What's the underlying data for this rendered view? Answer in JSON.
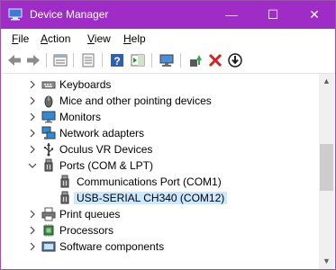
{
  "window": {
    "title": "Device Manager",
    "controls": {
      "minimize": "—",
      "maximize": "☐",
      "close": "✕"
    }
  },
  "menu": [
    {
      "label": "File",
      "hotkey": "F"
    },
    {
      "label": "Action",
      "hotkey": "A"
    },
    {
      "label": "View",
      "hotkey": "V"
    },
    {
      "label": "Help",
      "hotkey": "H"
    }
  ],
  "toolbar": {
    "buttons": [
      "back-icon",
      "forward-icon",
      "properties-icon",
      "show-hide-icon",
      "help-icon",
      "action-pane-icon",
      "monitor-icon",
      "update-driver-icon",
      "uninstall-icon",
      "scan-download-icon"
    ]
  },
  "tree": {
    "items": [
      {
        "label": "Keyboards",
        "expander": "collapsed",
        "icon": "keyboard-icon"
      },
      {
        "label": "Mice and other pointing devices",
        "expander": "collapsed",
        "icon": "mouse-icon"
      },
      {
        "label": "Monitors",
        "expander": "collapsed",
        "icon": "monitor-icon"
      },
      {
        "label": "Network adapters",
        "expander": "collapsed",
        "icon": "network-icon"
      },
      {
        "label": "Oculus VR Devices",
        "expander": "collapsed",
        "icon": "usb-icon"
      },
      {
        "label": "Ports (COM & LPT)",
        "expander": "expanded",
        "icon": "port-icon"
      },
      {
        "label": "Communications Port (COM1)",
        "expander": "none",
        "icon": "port-icon",
        "child": true
      },
      {
        "label": "USB-SERIAL CH340 (COM12)",
        "expander": "none",
        "icon": "port-icon",
        "child": true,
        "selected": true
      },
      {
        "label": "Print queues",
        "expander": "collapsed",
        "icon": "printer-icon"
      },
      {
        "label": "Processors",
        "expander": "collapsed",
        "icon": "processor-icon"
      },
      {
        "label": "Software components",
        "expander": "collapsed",
        "icon": "software-icon"
      }
    ]
  },
  "colors": {
    "titlebar": "#9f2cc6",
    "selection": "#cce8ff"
  }
}
